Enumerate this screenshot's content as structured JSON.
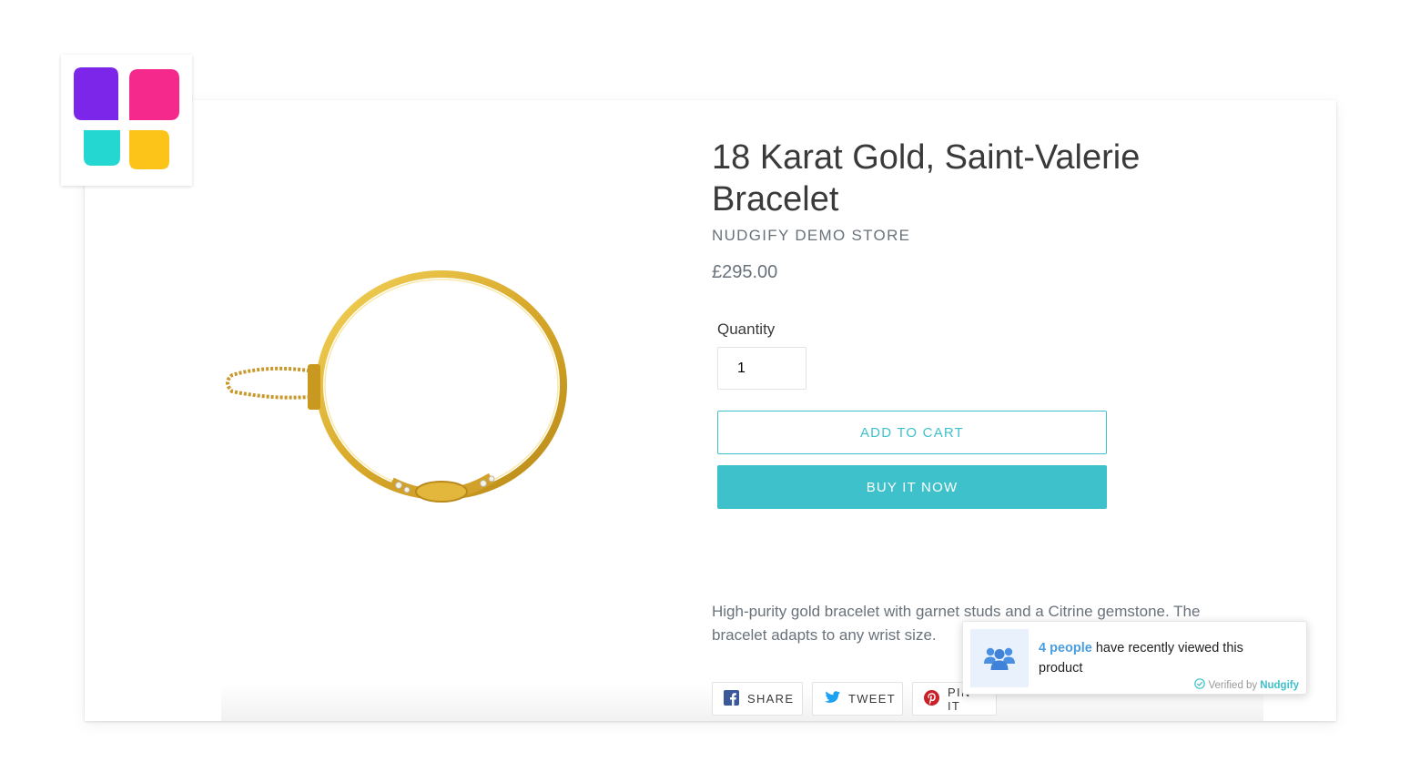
{
  "brand": {
    "logo_icon": "nudgify-logo-icon",
    "colors": {
      "purple": "#7b26e8",
      "pink": "#f5288c",
      "teal": "#24d7d0",
      "yellow": "#fcc419"
    }
  },
  "product": {
    "title": "18 Karat Gold, Saint-Valerie Bracelet",
    "vendor": "NUDGIFY DEMO STORE",
    "price": "£295.00",
    "quantity_label": "Quantity",
    "quantity_value": "1",
    "add_to_cart_label": "ADD TO CART",
    "buy_now_label": "BUY IT NOW",
    "description": "High-purity gold bracelet with garnet studs and a Citrine gemstone. The bracelet adapts to any wrist size.",
    "image_icon": "gold-bracelet-image"
  },
  "share": {
    "facebook_label": "SHARE",
    "twitter_label": "TWEET",
    "pinterest_label": "PIN IT"
  },
  "notification": {
    "icon": "people-group-icon",
    "count_text": "4 people",
    "message": " have recently viewed this product",
    "verified_prefix": "Verified by",
    "verified_brand": "Nudgify"
  },
  "colors": {
    "accent": "#3ec1ca",
    "link_blue": "#4a9ee0",
    "text_dark": "#3a3a3a",
    "text_muted": "#69727b"
  }
}
